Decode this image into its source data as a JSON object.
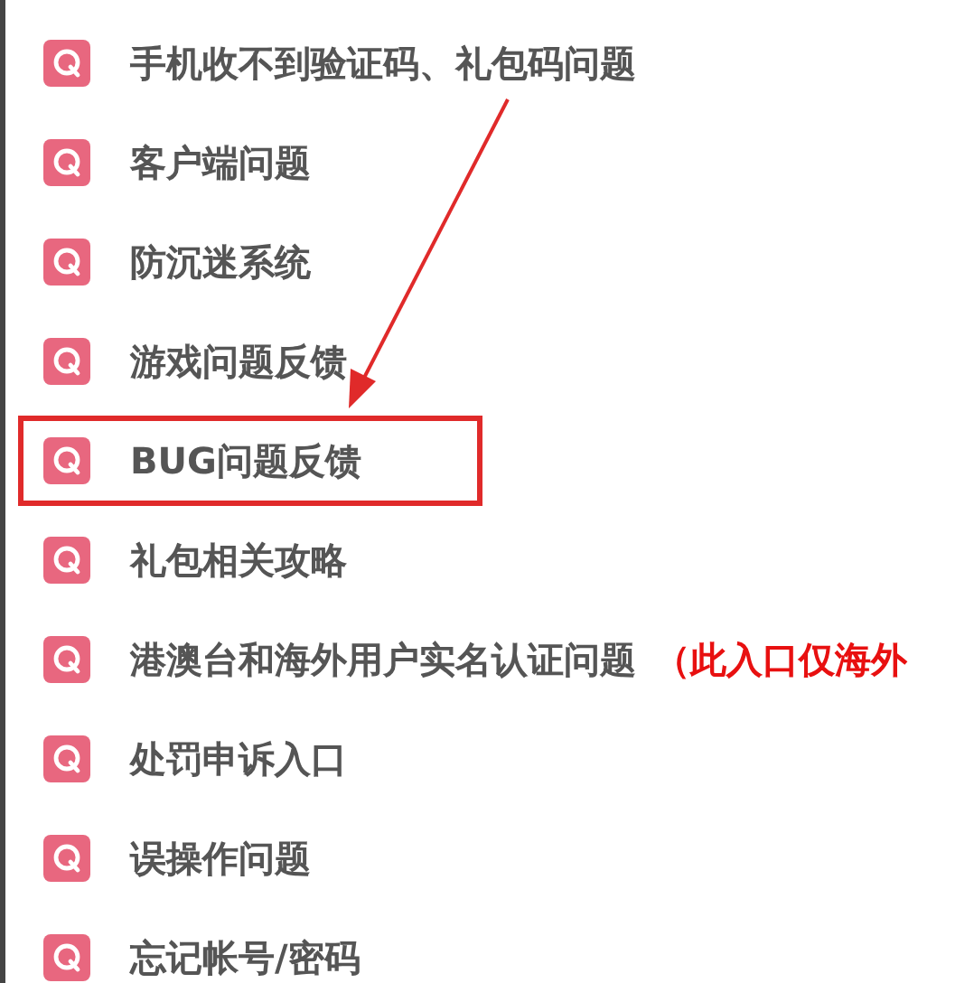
{
  "items": [
    {
      "label": "手机收不到验证码、礼包码问题",
      "highlighted": false
    },
    {
      "label": "客户端问题",
      "highlighted": false
    },
    {
      "label": "防沉迷系统",
      "highlighted": false
    },
    {
      "label": "游戏问题反馈",
      "highlighted": false
    },
    {
      "label": "BUG问题反馈",
      "highlighted": true
    },
    {
      "label": "礼包相关攻略",
      "highlighted": false
    },
    {
      "label": "港澳台和海外用户实名认证问题",
      "note": "（此入口仅海外",
      "highlighted": false
    },
    {
      "label": "处罚申诉入口",
      "highlighted": false
    },
    {
      "label": "误操作问题",
      "highlighted": false
    },
    {
      "label": "忘记帐号/密码",
      "highlighted": false
    }
  ]
}
